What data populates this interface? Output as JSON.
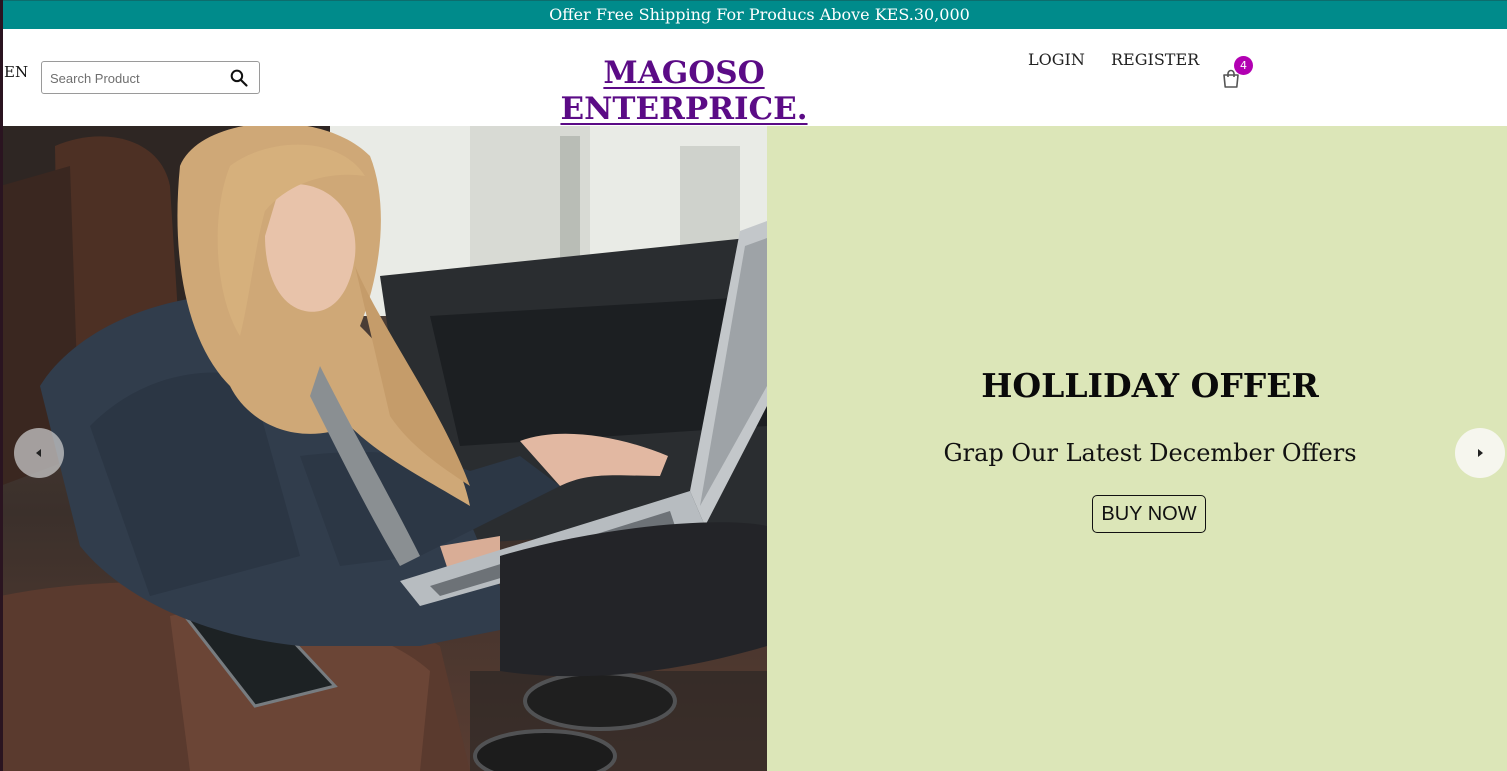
{
  "announcement": {
    "text": "Offer Free Shipping For Producs Above KES.30,000",
    "background": "#008b8b"
  },
  "header": {
    "language": "EN",
    "search": {
      "placeholder": "Search Product",
      "value": "",
      "icon": "search-icon"
    },
    "logo": "MAGOSO ENTERPRICE.",
    "logo_color": "#5b0b86",
    "nav": {
      "login": "LOGIN",
      "register": "REGISTER"
    },
    "cart": {
      "icon": "shopping-bag-icon",
      "count": "4",
      "badge_color": "#b200b2"
    }
  },
  "slider": {
    "background": "#dce6b8",
    "title": "HOLLIDAY OFFER",
    "subtitle": "Grap Our Latest December Offers",
    "button_label": "BUY NOW",
    "image": "woman-using-laptop-in-car",
    "prev_icon": "caret-left-icon",
    "next_icon": "caret-right-icon"
  }
}
